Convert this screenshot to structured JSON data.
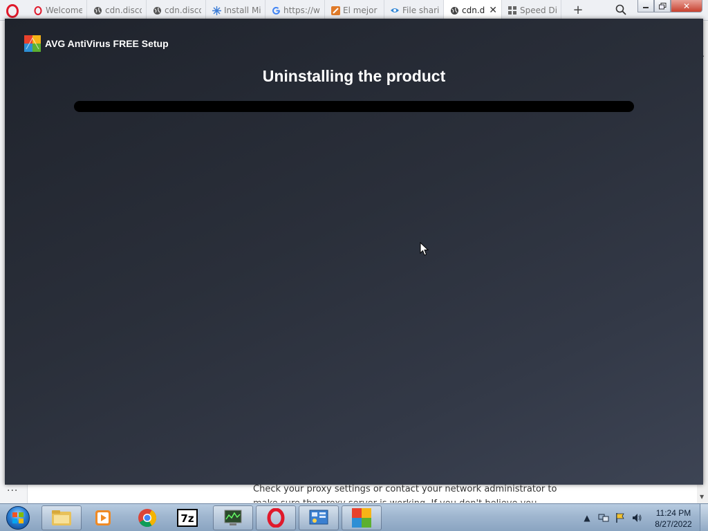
{
  "browser": {
    "tabs": [
      {
        "title": "Welcome",
        "icon": "opera-icon",
        "active": false
      },
      {
        "title": "cdn.disco",
        "icon": "globe-icon",
        "active": false
      },
      {
        "title": "cdn.disco",
        "icon": "globe-icon",
        "active": false
      },
      {
        "title": "Install Mi",
        "icon": "sparkle-icon",
        "active": false
      },
      {
        "title": "https://w",
        "icon": "google-icon",
        "active": false
      },
      {
        "title": "El mejor a",
        "icon": "site-icon",
        "active": false
      },
      {
        "title": "File sharin",
        "icon": "share-icon",
        "active": false
      },
      {
        "title": "cdn.di",
        "icon": "globe-icon",
        "active": true
      },
      {
        "title": "Speed Di",
        "icon": "grid-icon",
        "active": false
      }
    ],
    "new_tab": "+",
    "page_text_line1": "Check your proxy settings or contact your network administrator to",
    "page_text_line2": "make sure the proxy server is working. If you don't believe you",
    "more_label": "···"
  },
  "setup": {
    "app_title": "AVG AntiVirus FREE Setup",
    "heading": "Uninstalling the product",
    "progress": 0,
    "accent_color": "#7bc142"
  },
  "taskbar": {
    "apps": [
      {
        "name": "explorer",
        "icon": "folder-icon"
      },
      {
        "name": "media",
        "icon": "media-player-icon"
      },
      {
        "name": "chrome",
        "icon": "chrome-icon"
      },
      {
        "name": "7zip",
        "icon": "7zip-icon"
      },
      {
        "name": "task-manager",
        "icon": "task-manager-icon"
      },
      {
        "name": "opera",
        "icon": "opera-icon"
      },
      {
        "name": "control-panel",
        "icon": "control-panel-icon"
      },
      {
        "name": "avg",
        "icon": "avg-icon"
      }
    ],
    "time": "11:24 PM",
    "date": "8/27/2022"
  }
}
